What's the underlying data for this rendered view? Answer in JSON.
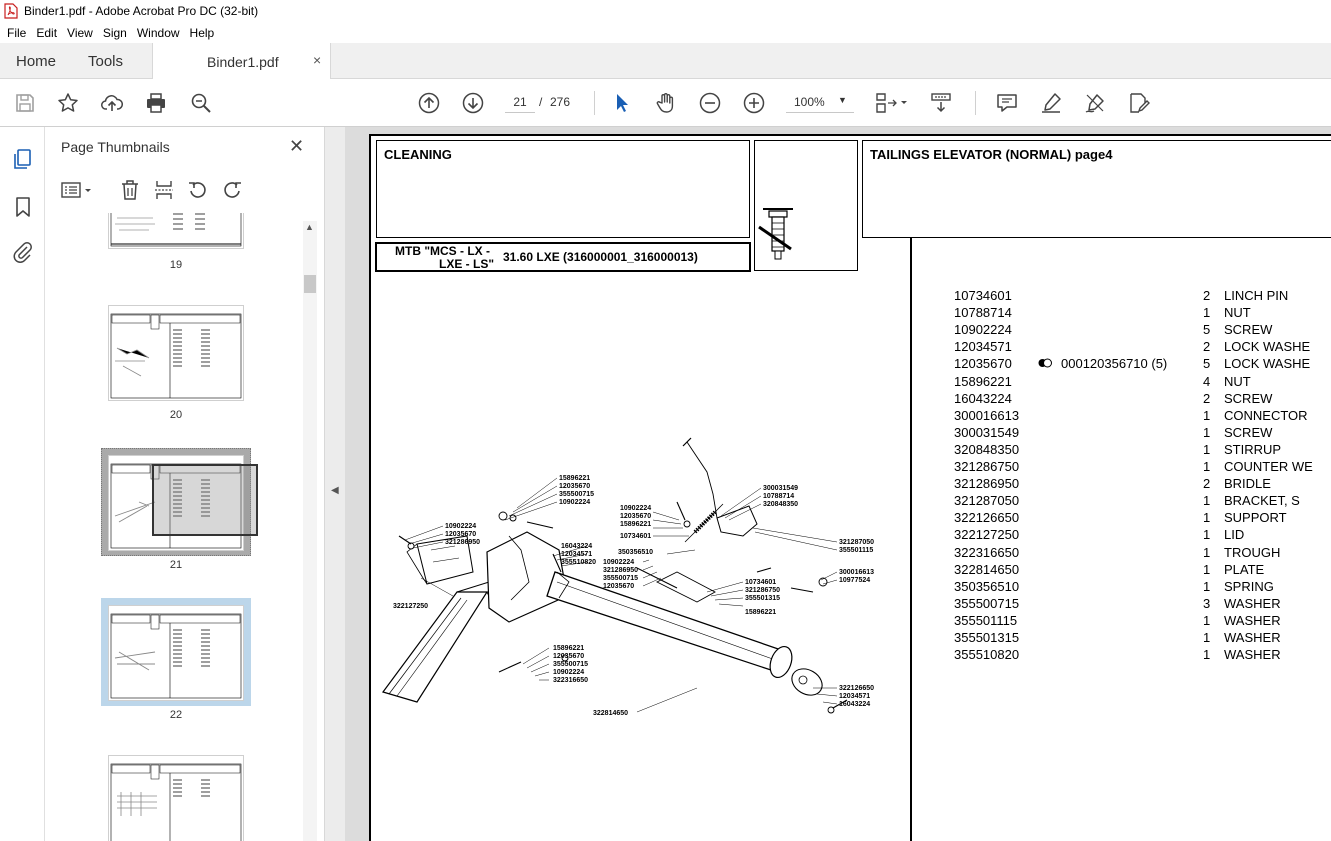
{
  "window": {
    "title": "Binder1.pdf - Adobe Acrobat Pro DC (32-bit)"
  },
  "menu": {
    "items": [
      "File",
      "Edit",
      "View",
      "Sign",
      "Window",
      "Help"
    ]
  },
  "tabs": {
    "home": "Home",
    "tools": "Tools",
    "document": "Binder1.pdf",
    "close": "×"
  },
  "toolbar": {
    "current_page": "21",
    "page_sep": "/",
    "total_pages": "276",
    "zoom": "100%"
  },
  "panel": {
    "title": "Page Thumbnails",
    "thumbnails": [
      {
        "label": "19"
      },
      {
        "label": "20"
      },
      {
        "label": "21"
      },
      {
        "label": "22"
      }
    ]
  },
  "pdf": {
    "section": "CLEANING",
    "group_title": "TAILINGS ELEVATOR (NORMAL)  page4",
    "mtb_line1": "MTB \"MCS - LX -",
    "mtb_line2": "LXE - LS\"",
    "mtb_model": "31.60 LXE (316000001_316000013)",
    "parts": [
      {
        "pn": "10734601",
        "alt": "",
        "qty": "2",
        "desc": "LINCH PIN"
      },
      {
        "pn": "10788714",
        "alt": "",
        "qty": "1",
        "desc": "NUT"
      },
      {
        "pn": "10902224",
        "alt": "",
        "qty": "5",
        "desc": "SCREW"
      },
      {
        "pn": "12034571",
        "alt": "",
        "qty": "2",
        "desc": "LOCK WASHE"
      },
      {
        "pn": "12035670",
        "alt": "000120356710  (5)",
        "qty": "5",
        "desc": "LOCK WASHE"
      },
      {
        "pn": "15896221",
        "alt": "",
        "qty": "4",
        "desc": "NUT"
      },
      {
        "pn": "16043224",
        "alt": "",
        "qty": "2",
        "desc": "SCREW"
      },
      {
        "pn": "300016613",
        "alt": "",
        "qty": "1",
        "desc": "CONNECTOR"
      },
      {
        "pn": "300031549",
        "alt": "",
        "qty": "1",
        "desc": "SCREW"
      },
      {
        "pn": "320848350",
        "alt": "",
        "qty": "1",
        "desc": "STIRRUP"
      },
      {
        "pn": "321286750",
        "alt": "",
        "qty": "1",
        "desc": "COUNTER WE"
      },
      {
        "pn": "321286950",
        "alt": "",
        "qty": "2",
        "desc": "BRIDLE"
      },
      {
        "pn": "321287050",
        "alt": "",
        "qty": "1",
        "desc": "BRACKET, S"
      },
      {
        "pn": "322126650",
        "alt": "",
        "qty": "1",
        "desc": "SUPPORT"
      },
      {
        "pn": "322127250",
        "alt": "",
        "qty": "1",
        "desc": "LID"
      },
      {
        "pn": "322316650",
        "alt": "",
        "qty": "1",
        "desc": "TROUGH"
      },
      {
        "pn": "322814650",
        "alt": "",
        "qty": "1",
        "desc": "PLATE"
      },
      {
        "pn": "350356510",
        "alt": "",
        "qty": "1",
        "desc": "SPRING"
      },
      {
        "pn": "355500715",
        "alt": "",
        "qty": "3",
        "desc": "WASHER"
      },
      {
        "pn": "355501115",
        "alt": "",
        "qty": "1",
        "desc": "WASHER"
      },
      {
        "pn": "355501315",
        "alt": "",
        "qty": "1",
        "desc": "WASHER"
      },
      {
        "pn": "355510820",
        "alt": "",
        "qty": "1",
        "desc": "WASHER"
      }
    ],
    "callouts": {
      "c1": "15896221",
      "c2": "12035670",
      "c3": "355500715",
      "c4": "10902224",
      "c5": "10902224",
      "c6": "12035670",
      "c7": "321286950",
      "c8": "300031549",
      "c9": "10788714",
      "c10": "320848350",
      "c11": "10902224",
      "c12": "12035670",
      "c13": "15896221",
      "c14": "10734601",
      "c15": "350356510",
      "c16": "16043224",
      "c17": "12034571",
      "c18": "355510820",
      "c19": "321287050",
      "c20": "355501115",
      "c21": "10902224",
      "c22": "321286950",
      "c23": "355500715",
      "c24": "12035670",
      "c25": "300016613",
      "c26": "10977524",
      "c27": "10734601",
      "c28": "321286750",
      "c29": "355501315",
      "c30": "15896221",
      "c31": "322127250",
      "c32": "15896221",
      "c33": "12035670",
      "c34": "355500715",
      "c35": "10902224",
      "c36": "322316650",
      "c37": "322126650",
      "c38": "12034571",
      "c39": "16043224",
      "c40": "322814650"
    }
  },
  "icons": {
    "save": "save-icon",
    "star": "bookmark-star-icon",
    "upload": "upload-icon",
    "print": "print-icon",
    "zoom_search": "find-zoom-icon",
    "prev_page": "prev-page-icon",
    "next_page": "next-page-icon",
    "select": "select-arrow-icon",
    "hand": "hand-icon",
    "zoom_out": "zoom-out-icon",
    "zoom_in": "zoom-in-icon",
    "fit": "page-fit-icon",
    "scroll_mode": "scroll-mode-icon",
    "comment": "comment-icon",
    "highlight": "highlight-pen-icon",
    "sign": "sign-icon",
    "more_tools": "more-tools-icon"
  }
}
